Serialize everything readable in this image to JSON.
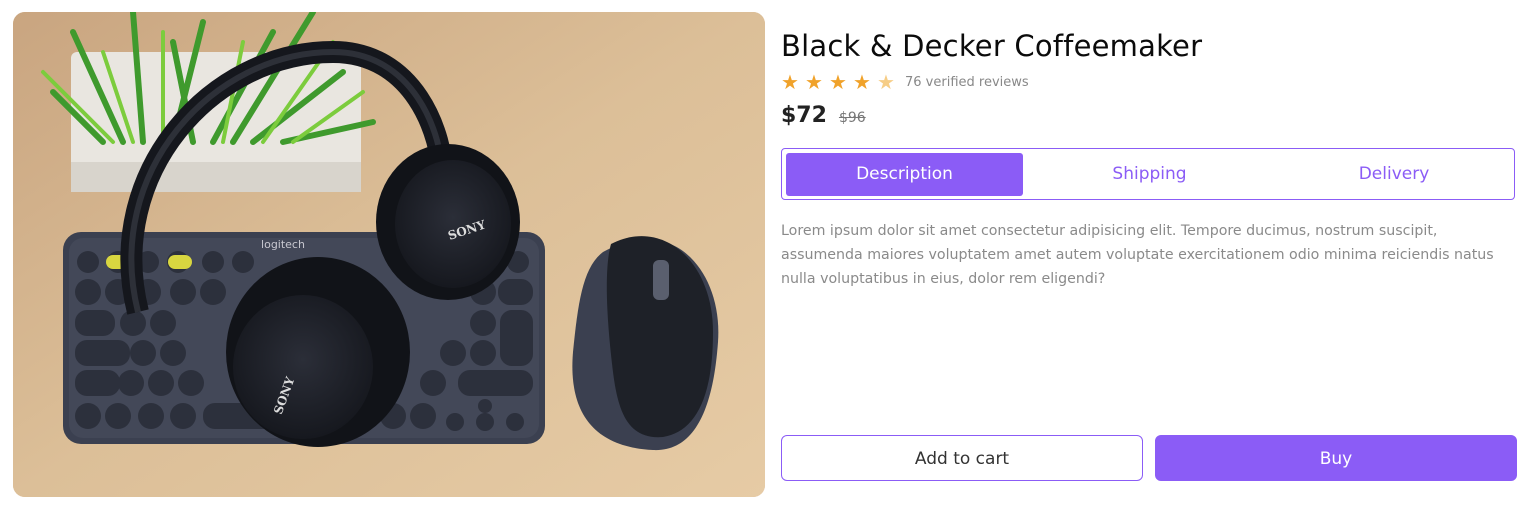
{
  "product": {
    "title": "Black & Decker Coffeemaker",
    "rating": 4.5,
    "rating_max": 5,
    "reviews_text": "76 verified reviews",
    "price": "$72",
    "old_price": "$96",
    "image_icon": "product-photo"
  },
  "tabs": [
    {
      "label": "Description",
      "active": true
    },
    {
      "label": "Shipping",
      "active": false
    },
    {
      "label": "Delivery",
      "active": false
    }
  ],
  "description": "Lorem ipsum dolor sit amet consectetur adipisicing elit. Tempore ducimus, nostrum suscipit, assumenda maiores voluptatem amet autem voluptate exercitationem odio minima reiciendis natus nulla voluptatibus in eius, dolor rem eligendi?",
  "photo_labels": {
    "keyboard_brand": "logitech",
    "headphone_brand": "SONY"
  },
  "buttons": {
    "add_to_cart": "Add to cart",
    "buy": "Buy"
  },
  "colors": {
    "accent": "#8b5cf6",
    "star": "#f0a22a",
    "text_muted": "#8a8a8a"
  }
}
